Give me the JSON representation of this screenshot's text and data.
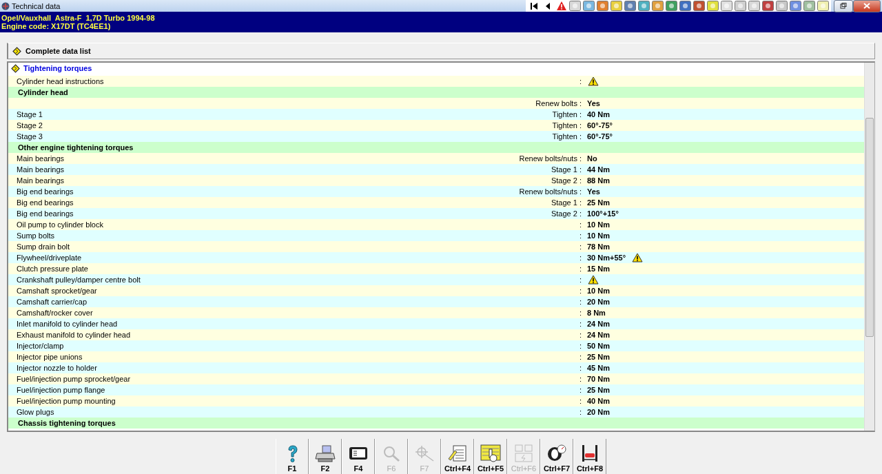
{
  "window": {
    "title": "Technical data"
  },
  "vehicle": {
    "model": "Opel/Vauxhall  Astra-F  1,7D Turbo 1994-98",
    "engine": "Engine code: X17DT (TC4EE1)"
  },
  "complete_list": {
    "label": "Complete data list"
  },
  "panel": {
    "title": "Tightening torques",
    "rows": [
      {
        "kind": "item",
        "label": "Cylinder head instructions",
        "qualifier": ":",
        "value": "",
        "warning": true
      },
      {
        "kind": "section",
        "label": "Cylinder head"
      },
      {
        "kind": "item",
        "label": "",
        "qualifier": "Renew bolts :",
        "value": "Yes",
        "warning": false
      },
      {
        "kind": "item",
        "label": "Stage 1",
        "qualifier": "Tighten :",
        "value": "40 Nm",
        "warning": false
      },
      {
        "kind": "item",
        "label": "Stage 2",
        "qualifier": "Tighten :",
        "value": "60°-75°",
        "warning": false
      },
      {
        "kind": "item",
        "label": "Stage 3",
        "qualifier": "Tighten :",
        "value": "60°-75°",
        "warning": false
      },
      {
        "kind": "section",
        "label": "Other engine tightening torques"
      },
      {
        "kind": "item",
        "label": "Main bearings",
        "qualifier": "Renew bolts/nuts :",
        "value": "No",
        "warning": false
      },
      {
        "kind": "item",
        "label": "Main bearings",
        "qualifier": "Stage 1 :",
        "value": "44 Nm",
        "warning": false
      },
      {
        "kind": "item",
        "label": "Main bearings",
        "qualifier": "Stage 2 :",
        "value": "88 Nm",
        "warning": false
      },
      {
        "kind": "item",
        "label": "Big end bearings",
        "qualifier": "Renew bolts/nuts :",
        "value": "Yes",
        "warning": false
      },
      {
        "kind": "item",
        "label": "Big end bearings",
        "qualifier": "Stage 1 :",
        "value": "25 Nm",
        "warning": false
      },
      {
        "kind": "item",
        "label": "Big end bearings",
        "qualifier": "Stage 2 :",
        "value": "100°+15°",
        "warning": false
      },
      {
        "kind": "item",
        "label": "Oil pump to cylinder block",
        "qualifier": ":",
        "value": "10 Nm",
        "warning": false
      },
      {
        "kind": "item",
        "label": "Sump bolts",
        "qualifier": ":",
        "value": "10 Nm",
        "warning": false
      },
      {
        "kind": "item",
        "label": "Sump drain bolt",
        "qualifier": ":",
        "value": "78 Nm",
        "warning": false
      },
      {
        "kind": "item",
        "label": "Flywheel/driveplate",
        "qualifier": ":",
        "value": "30 Nm+55°",
        "warning": true
      },
      {
        "kind": "item",
        "label": "Clutch pressure plate",
        "qualifier": ":",
        "value": "15 Nm",
        "warning": false
      },
      {
        "kind": "item",
        "label": "Crankshaft pulley/damper centre bolt",
        "qualifier": ":",
        "value": "",
        "warning": true
      },
      {
        "kind": "item",
        "label": "Camshaft sprocket/gear",
        "qualifier": ":",
        "value": "10 Nm",
        "warning": false
      },
      {
        "kind": "item",
        "label": "Camshaft carrier/cap",
        "qualifier": ":",
        "value": "20 Nm",
        "warning": false
      },
      {
        "kind": "item",
        "label": "Camshaft/rocker cover",
        "qualifier": ":",
        "value": "8 Nm",
        "warning": false
      },
      {
        "kind": "item",
        "label": "Inlet manifold to cylinder head",
        "qualifier": ":",
        "value": "24 Nm",
        "warning": false
      },
      {
        "kind": "item",
        "label": "Exhaust manifold to cylinder head",
        "qualifier": ":",
        "value": "24 Nm",
        "warning": false
      },
      {
        "kind": "item",
        "label": "Injector/clamp",
        "qualifier": ":",
        "value": "50 Nm",
        "warning": false
      },
      {
        "kind": "item",
        "label": "Injector pipe unions",
        "qualifier": ":",
        "value": "25 Nm",
        "warning": false
      },
      {
        "kind": "item",
        "label": "Injector nozzle to holder",
        "qualifier": ":",
        "value": "45 Nm",
        "warning": false
      },
      {
        "kind": "item",
        "label": "Fuel/injection pump sprocket/gear",
        "qualifier": ":",
        "value": "70 Nm",
        "warning": false
      },
      {
        "kind": "item",
        "label": "Fuel/injection pump flange",
        "qualifier": ":",
        "value": "25 Nm",
        "warning": false
      },
      {
        "kind": "item",
        "label": "Fuel/injection pump mounting",
        "qualifier": ":",
        "value": "40 Nm",
        "warning": false
      },
      {
        "kind": "item",
        "label": "Glow plugs",
        "qualifier": ":",
        "value": "20 Nm",
        "warning": false
      },
      {
        "kind": "section",
        "label": "Chassis tightening torques"
      }
    ]
  },
  "function_keys": [
    {
      "label": "F1",
      "kind": "help",
      "disabled": false
    },
    {
      "label": "F2",
      "kind": "print",
      "disabled": false
    },
    {
      "label": "F4",
      "kind": "display",
      "disabled": false
    },
    {
      "label": "F6",
      "kind": "search",
      "disabled": true
    },
    {
      "label": "F7",
      "kind": "measure",
      "disabled": true
    },
    {
      "label": "Ctrl+F4",
      "kind": "notes",
      "disabled": false
    },
    {
      "label": "Ctrl+F5",
      "kind": "select",
      "disabled": false
    },
    {
      "label": "Ctrl+F6",
      "kind": "electric",
      "disabled": true
    },
    {
      "label": "Ctrl+F7",
      "kind": "diagnose",
      "disabled": false
    },
    {
      "label": "Ctrl+F8",
      "kind": "lift",
      "disabled": false
    }
  ]
}
